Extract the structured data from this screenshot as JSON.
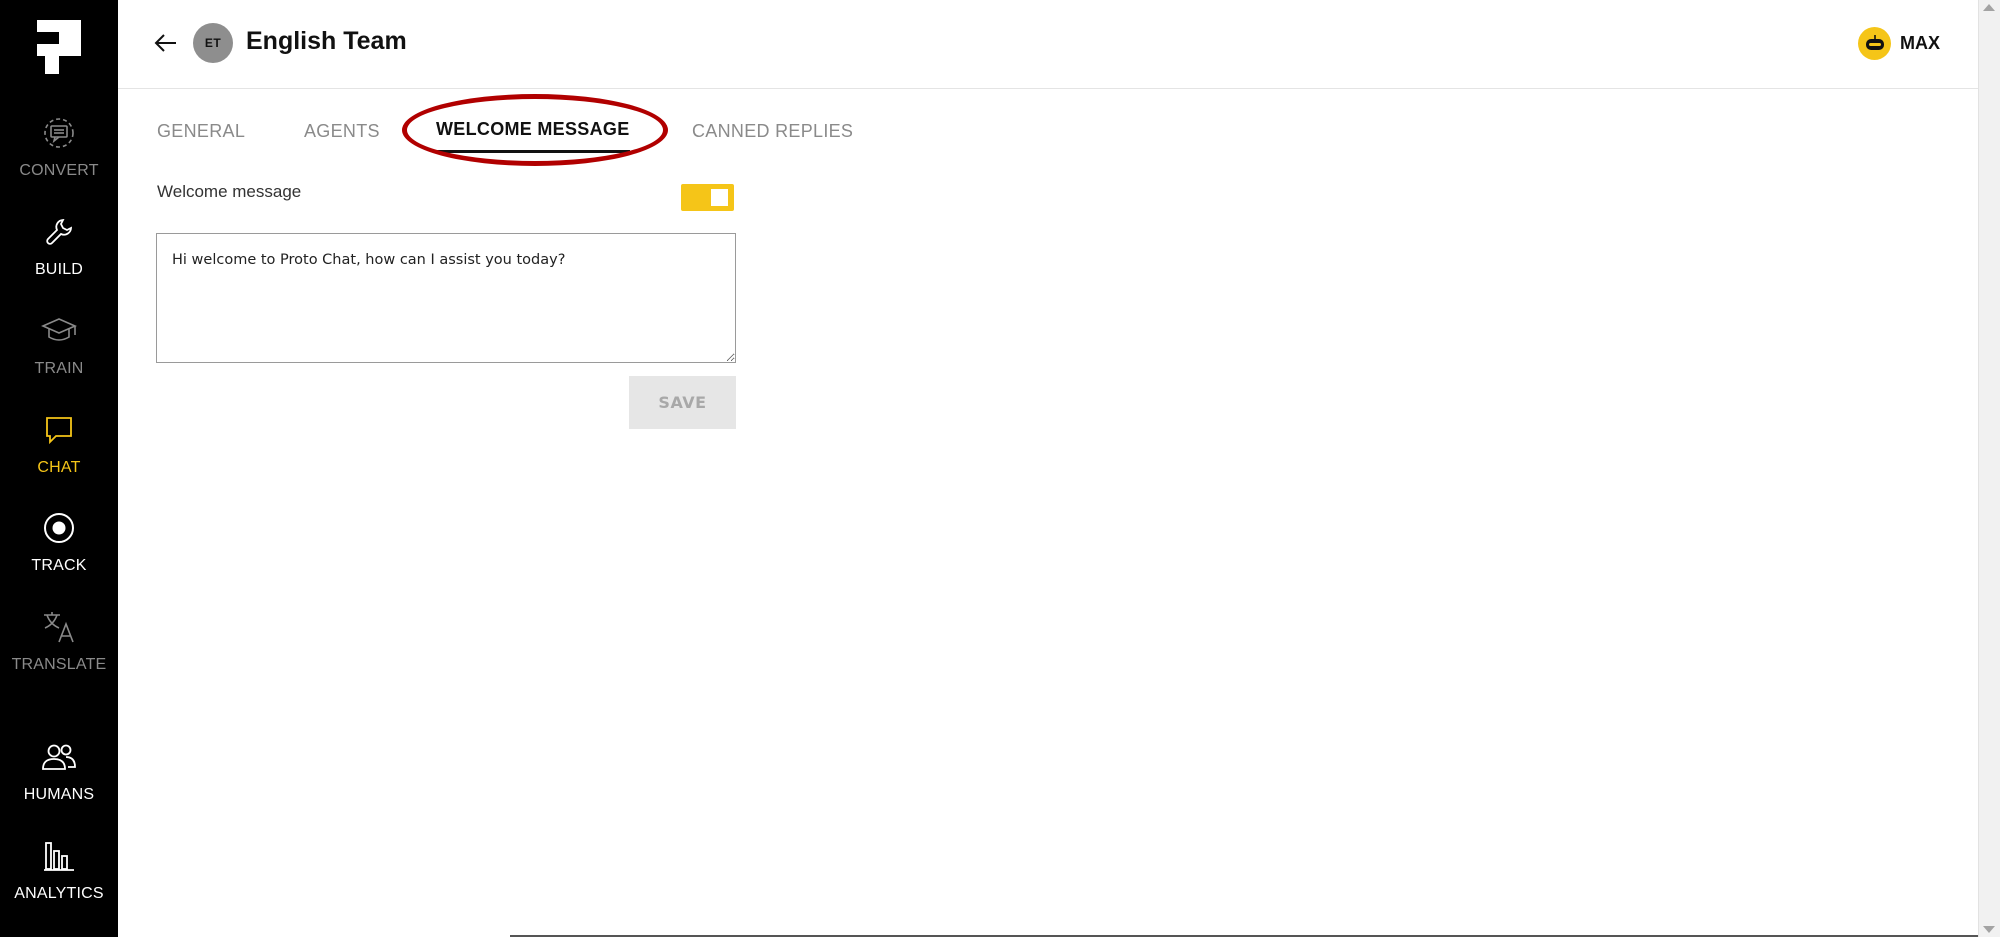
{
  "sidebar": {
    "items": [
      {
        "label": "CONVERT",
        "icon": "chat-convert-icon"
      },
      {
        "label": "BUILD",
        "icon": "wrench-icon"
      },
      {
        "label": "TRAIN",
        "icon": "graduation-cap-icon"
      },
      {
        "label": "CHAT",
        "icon": "chat-bubble-icon"
      },
      {
        "label": "TRACK",
        "icon": "target-icon"
      },
      {
        "label": "TRANSLATE",
        "icon": "translate-icon"
      },
      {
        "label": "HUMANS",
        "icon": "people-icon"
      },
      {
        "label": "ANALYTICS",
        "icon": "bar-chart-icon"
      }
    ],
    "active_item": "CHAT"
  },
  "header": {
    "avatar_initials": "ET",
    "title": "English Team",
    "user_name": "MAX"
  },
  "tabs": [
    {
      "label": "GENERAL"
    },
    {
      "label": "AGENTS"
    },
    {
      "label": "WELCOME MESSAGE"
    },
    {
      "label": "CANNED REPLIES"
    }
  ],
  "active_tab": "WELCOME MESSAGE",
  "form": {
    "welcome_label": "Welcome message",
    "welcome_enabled": true,
    "welcome_text": "Hi welcome to Proto Chat, how can I assist you today?",
    "save_label": "SAVE"
  },
  "colors": {
    "accent": "#f5c518",
    "sidebar_bg": "#000000",
    "highlight_ring": "#b10000"
  }
}
